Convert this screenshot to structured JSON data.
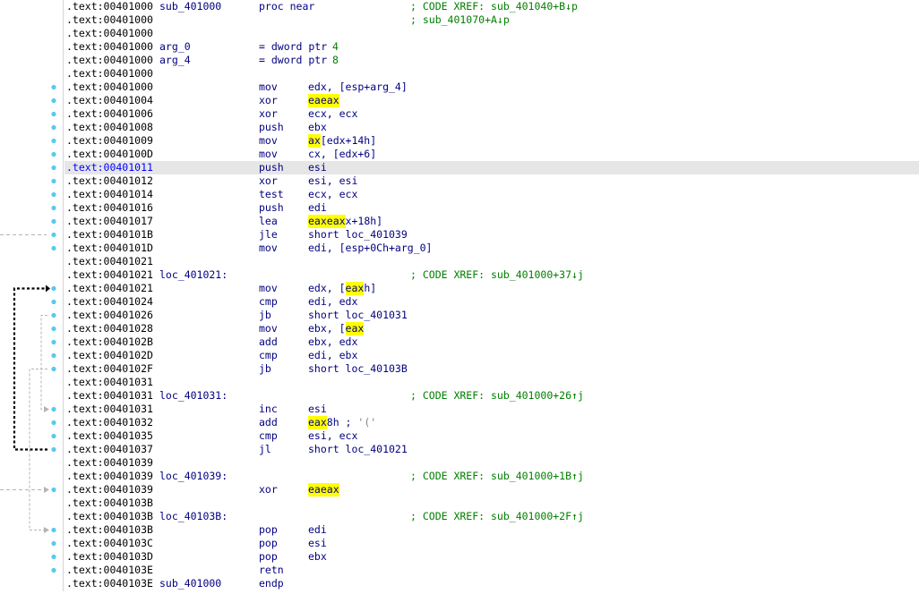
{
  "lines": [
    {
      "addr": ".text:00401000",
      "name": "sub_401000",
      "mnem": "proc near",
      "ops": "",
      "cmt": "; CODE XREF: sub_401040+B↓p"
    },
    {
      "addr": ".text:00401000",
      "name": "",
      "mnem": "",
      "ops": "",
      "cmt": "; sub_401070+A↓p"
    },
    {
      "addr": ".text:00401000",
      "name": "",
      "mnem": "",
      "ops": "",
      "cmt": ""
    },
    {
      "addr": ".text:00401000",
      "name": "arg_0",
      "mnem": "= dword ptr",
      "ops": "4",
      "cmt": ""
    },
    {
      "addr": ".text:00401000",
      "name": "arg_4",
      "mnem": "= dword ptr",
      "ops": "8",
      "cmt": ""
    },
    {
      "addr": ".text:00401000",
      "name": "",
      "mnem": "",
      "ops": "",
      "cmt": ""
    },
    {
      "addr": ".text:00401000",
      "name": "",
      "mnem": "mov",
      "ops": "edx, [esp+arg_4]",
      "cmt": ""
    },
    {
      "addr": ".text:00401004",
      "name": "",
      "mnem": "xor",
      "ops": "eax, eax",
      "cmt": ""
    },
    {
      "addr": ".text:00401006",
      "name": "",
      "mnem": "xor",
      "ops": "ecx, ecx",
      "cmt": ""
    },
    {
      "addr": ".text:00401008",
      "name": "",
      "mnem": "push",
      "ops": "ebx",
      "cmt": ""
    },
    {
      "addr": ".text:00401009",
      "name": "",
      "mnem": "mov",
      "ops": "ax, [edx+14h]",
      "cmt": ""
    },
    {
      "addr": ".text:0040100D",
      "name": "",
      "mnem": "mov",
      "ops": "cx, [edx+6]",
      "cmt": ""
    },
    {
      "addr": ".text:00401011",
      "name": "",
      "mnem": "push",
      "ops": "esi",
      "cmt": ""
    },
    {
      "addr": ".text:00401012",
      "name": "",
      "mnem": "xor",
      "ops": "esi, esi",
      "cmt": ""
    },
    {
      "addr": ".text:00401014",
      "name": "",
      "mnem": "test",
      "ops": "ecx, ecx",
      "cmt": ""
    },
    {
      "addr": ".text:00401016",
      "name": "",
      "mnem": "push",
      "ops": "edi",
      "cmt": ""
    },
    {
      "addr": ".text:00401017",
      "name": "",
      "mnem": "lea",
      "ops": "eax, [eax+edx+18h]",
      "cmt": ""
    },
    {
      "addr": ".text:0040101B",
      "name": "",
      "mnem": "jle",
      "ops": "short loc_401039",
      "cmt": ""
    },
    {
      "addr": ".text:0040101D",
      "name": "",
      "mnem": "mov",
      "ops": "edi, [esp+0Ch+arg_0]",
      "cmt": ""
    },
    {
      "addr": ".text:00401021",
      "name": "",
      "mnem": "",
      "ops": "",
      "cmt": ""
    },
    {
      "addr": ".text:00401021",
      "name": "loc_401021:",
      "mnem": "",
      "ops": "",
      "cmt": "; CODE XREF: sub_401000+37↓j"
    },
    {
      "addr": ".text:00401021",
      "name": "",
      "mnem": "mov",
      "ops": "edx, [eax+0Ch]",
      "cmt": ""
    },
    {
      "addr": ".text:00401024",
      "name": "",
      "mnem": "cmp",
      "ops": "edi, edx",
      "cmt": ""
    },
    {
      "addr": ".text:00401026",
      "name": "",
      "mnem": "jb",
      "ops": "short loc_401031",
      "cmt": ""
    },
    {
      "addr": ".text:00401028",
      "name": "",
      "mnem": "mov",
      "ops": "ebx, [eax+8]",
      "cmt": ""
    },
    {
      "addr": ".text:0040102B",
      "name": "",
      "mnem": "add",
      "ops": "ebx, edx",
      "cmt": ""
    },
    {
      "addr": ".text:0040102D",
      "name": "",
      "mnem": "cmp",
      "ops": "edi, ebx",
      "cmt": ""
    },
    {
      "addr": ".text:0040102F",
      "name": "",
      "mnem": "jb",
      "ops": "short loc_40103B",
      "cmt": ""
    },
    {
      "addr": ".text:00401031",
      "name": "",
      "mnem": "",
      "ops": "",
      "cmt": ""
    },
    {
      "addr": ".text:00401031",
      "name": "loc_401031:",
      "mnem": "",
      "ops": "",
      "cmt": "; CODE XREF: sub_401000+26↑j"
    },
    {
      "addr": ".text:00401031",
      "name": "",
      "mnem": "inc",
      "ops": "esi",
      "cmt": ""
    },
    {
      "addr": ".text:00401032",
      "name": "",
      "mnem": "add",
      "ops": "eax, 28h ; '('",
      "cmt": ""
    },
    {
      "addr": ".text:00401035",
      "name": "",
      "mnem": "cmp",
      "ops": "esi, ecx",
      "cmt": ""
    },
    {
      "addr": ".text:00401037",
      "name": "",
      "mnem": "jl",
      "ops": "short loc_401021",
      "cmt": ""
    },
    {
      "addr": ".text:00401039",
      "name": "",
      "mnem": "",
      "ops": "",
      "cmt": ""
    },
    {
      "addr": ".text:00401039",
      "name": "loc_401039:",
      "mnem": "",
      "ops": "",
      "cmt": "; CODE XREF: sub_401000+1B↑j"
    },
    {
      "addr": ".text:00401039",
      "name": "",
      "mnem": "xor",
      "ops": "eax, eax",
      "cmt": ""
    },
    {
      "addr": ".text:0040103B",
      "name": "",
      "mnem": "",
      "ops": "",
      "cmt": ""
    },
    {
      "addr": ".text:0040103B",
      "name": "loc_40103B:",
      "mnem": "",
      "ops": "",
      "cmt": "; CODE XREF: sub_401000+2F↑j"
    },
    {
      "addr": ".text:0040103B",
      "name": "",
      "mnem": "pop",
      "ops": "edi",
      "cmt": ""
    },
    {
      "addr": ".text:0040103C",
      "name": "",
      "mnem": "pop",
      "ops": "esi",
      "cmt": ""
    },
    {
      "addr": ".text:0040103D",
      "name": "",
      "mnem": "pop",
      "ops": "ebx",
      "cmt": ""
    },
    {
      "addr": ".text:0040103E",
      "name": "",
      "mnem": "retn",
      "ops": "",
      "cmt": ""
    },
    {
      "addr": ".text:0040103E",
      "name": "sub_401000",
      "mnem": "endp",
      "ops": "",
      "cmt": ""
    }
  ],
  "current_line": 12,
  "highlight_register": "eax",
  "colors": {
    "address": "#000000",
    "address_current": "#0000ff",
    "code": "#000080",
    "comment": "#008000",
    "highlight": "#ffff00",
    "current_line_bg": "#e6e6e6",
    "breakpoint_dot": "#5bc8ee",
    "arrow_active": "#000000",
    "arrow_inactive": "#b4b4b4"
  }
}
